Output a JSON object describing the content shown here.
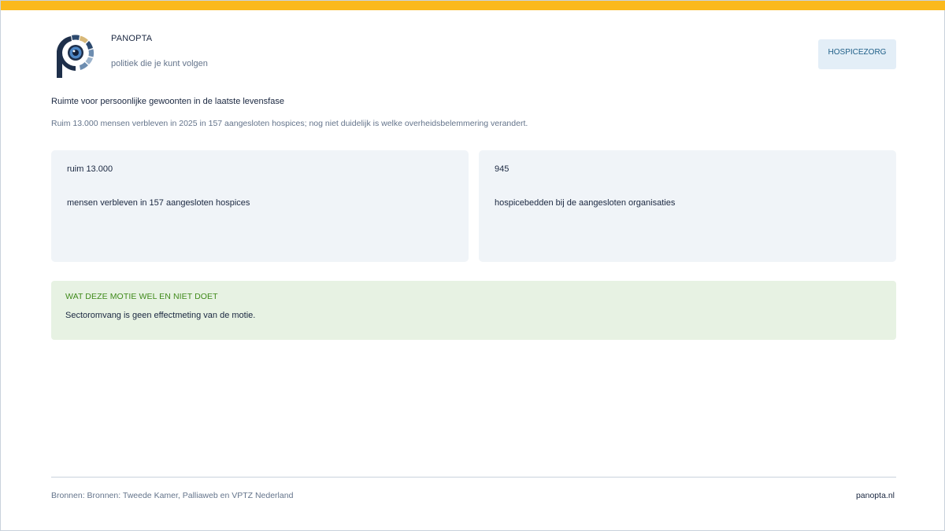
{
  "brand": {
    "name": "PANOPTA",
    "tagline": "politiek die je kunt volgen"
  },
  "topic_badge": "HOSPICEZORG",
  "headline": "Ruimte voor persoonlijke gewoonten in de laatste levensfase",
  "subline": "Ruim 13.000 mensen verbleven in 2025 in 157 aangesloten hospices; nog niet duidelijk is welke overheidsbelemmering verandert.",
  "cards": [
    {
      "value": "ruim 13.000",
      "description": "mensen verbleven in 157 aangesloten hospices"
    },
    {
      "value": "945",
      "description": "hospicebedden bij de aangesloten organisaties"
    }
  ],
  "notice": {
    "title": "WAT DEZE MOTIE WEL EN NIET DOET",
    "text": "Sectoromvang is geen effectmeting van de motie."
  },
  "footer": {
    "sources": "Bronnen: Bronnen: Tweede Kamer, Palliaweb en VPTZ Nederland",
    "site": "panopta.nl"
  },
  "colors": {
    "accent_bar": "#fbb91c",
    "navy": "#1a2740",
    "card_bg": "#f0f4f8",
    "badge_bg": "#e3eef7",
    "notice_bg": "#e7f2e3",
    "notice_title": "#3f8a1a"
  }
}
